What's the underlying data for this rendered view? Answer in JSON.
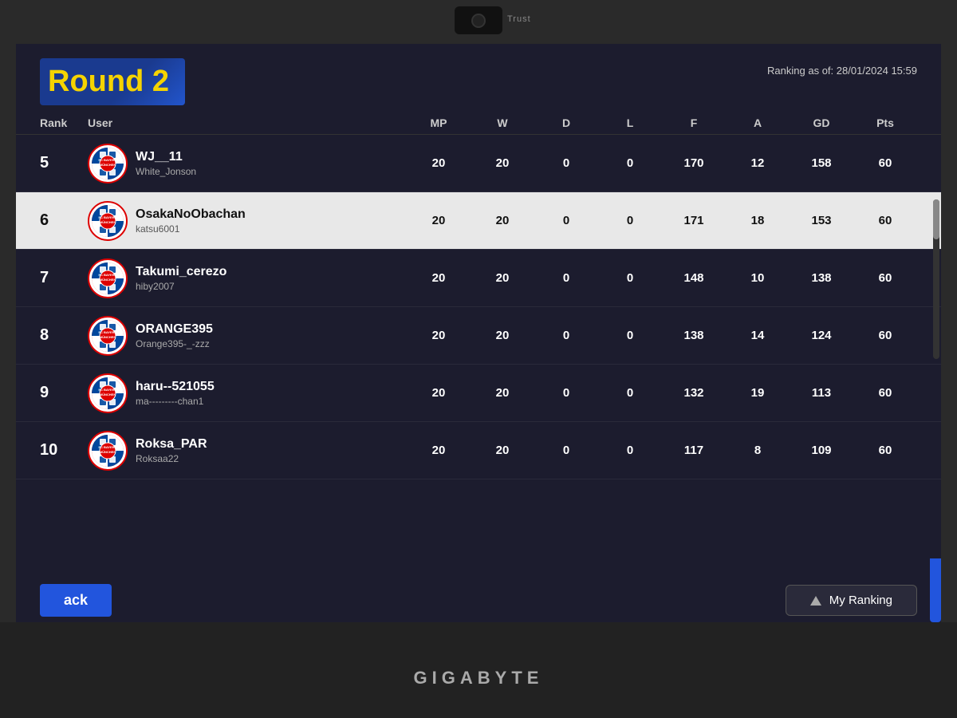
{
  "monitor": {
    "webcam_brand": "Trust",
    "brand": "GIGABYTE"
  },
  "header": {
    "title": "Round 2",
    "ranking_date_label": "Ranking as of:",
    "ranking_date": "28/01/2024 15:59"
  },
  "columns": {
    "rank": "Rank",
    "user": "User",
    "mp": "MP",
    "w": "W",
    "d": "D",
    "l": "L",
    "f": "F",
    "a": "A",
    "gd": "GD",
    "pts": "Pts"
  },
  "rows": [
    {
      "rank": "5",
      "username": "WJ__11",
      "sub_username": "White_Jonson",
      "mp": "20",
      "w": "20",
      "d": "0",
      "l": "0",
      "f": "170",
      "a": "12",
      "gd": "158",
      "pts": "60",
      "highlighted": false
    },
    {
      "rank": "6",
      "username": "OsakaNoObachan",
      "sub_username": "katsu6001",
      "mp": "20",
      "w": "20",
      "d": "0",
      "l": "0",
      "f": "171",
      "a": "18",
      "gd": "153",
      "pts": "60",
      "highlighted": true
    },
    {
      "rank": "7",
      "username": "Takumi_cerezo",
      "sub_username": "hiby2007",
      "mp": "20",
      "w": "20",
      "d": "0",
      "l": "0",
      "f": "148",
      "a": "10",
      "gd": "138",
      "pts": "60",
      "highlighted": false
    },
    {
      "rank": "8",
      "username": "ORANGE395",
      "sub_username": "Orange395-_-zzz",
      "mp": "20",
      "w": "20",
      "d": "0",
      "l": "0",
      "f": "138",
      "a": "14",
      "gd": "124",
      "pts": "60",
      "highlighted": false
    },
    {
      "rank": "9",
      "username": "haru--521055",
      "sub_username": "ma---------chan1",
      "mp": "20",
      "w": "20",
      "d": "0",
      "l": "0",
      "f": "132",
      "a": "19",
      "gd": "113",
      "pts": "60",
      "highlighted": false
    },
    {
      "rank": "10",
      "username": "Roksa_PAR",
      "sub_username": "Roksaa22",
      "mp": "20",
      "w": "20",
      "d": "0",
      "l": "0",
      "f": "117",
      "a": "8",
      "gd": "109",
      "pts": "60",
      "highlighted": false
    }
  ],
  "buttons": {
    "back": "ack",
    "my_ranking": "My Ranking"
  }
}
